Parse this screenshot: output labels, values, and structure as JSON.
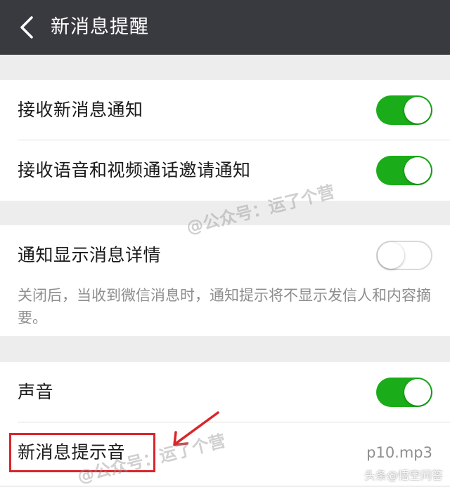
{
  "header": {
    "title": "新消息提醒"
  },
  "group1": {
    "items": [
      {
        "label": "接收新消息通知",
        "enabled": true
      },
      {
        "label": "接收语音和视频通话邀请通知",
        "enabled": true
      }
    ]
  },
  "group2": {
    "items": [
      {
        "label": "通知显示消息详情",
        "enabled": false
      }
    ],
    "note": "关闭后，当收到微信消息时，通知提示将不显示发信人和内容摘要。"
  },
  "group3": {
    "items": [
      {
        "label": "声音",
        "enabled": true
      },
      {
        "label": "新消息提示音",
        "value": "p10.mp3"
      }
    ]
  },
  "watermark": {
    "text": "@公众号：运了个营"
  },
  "corner": {
    "text": "头条@悟空问答"
  },
  "colors": {
    "topbar": "#393a3f",
    "toggle_on": "#1aad19",
    "highlight": "#d9262a"
  },
  "icons": {
    "back": "chevron-left-icon",
    "arrow": "arrow-annotation-icon"
  }
}
